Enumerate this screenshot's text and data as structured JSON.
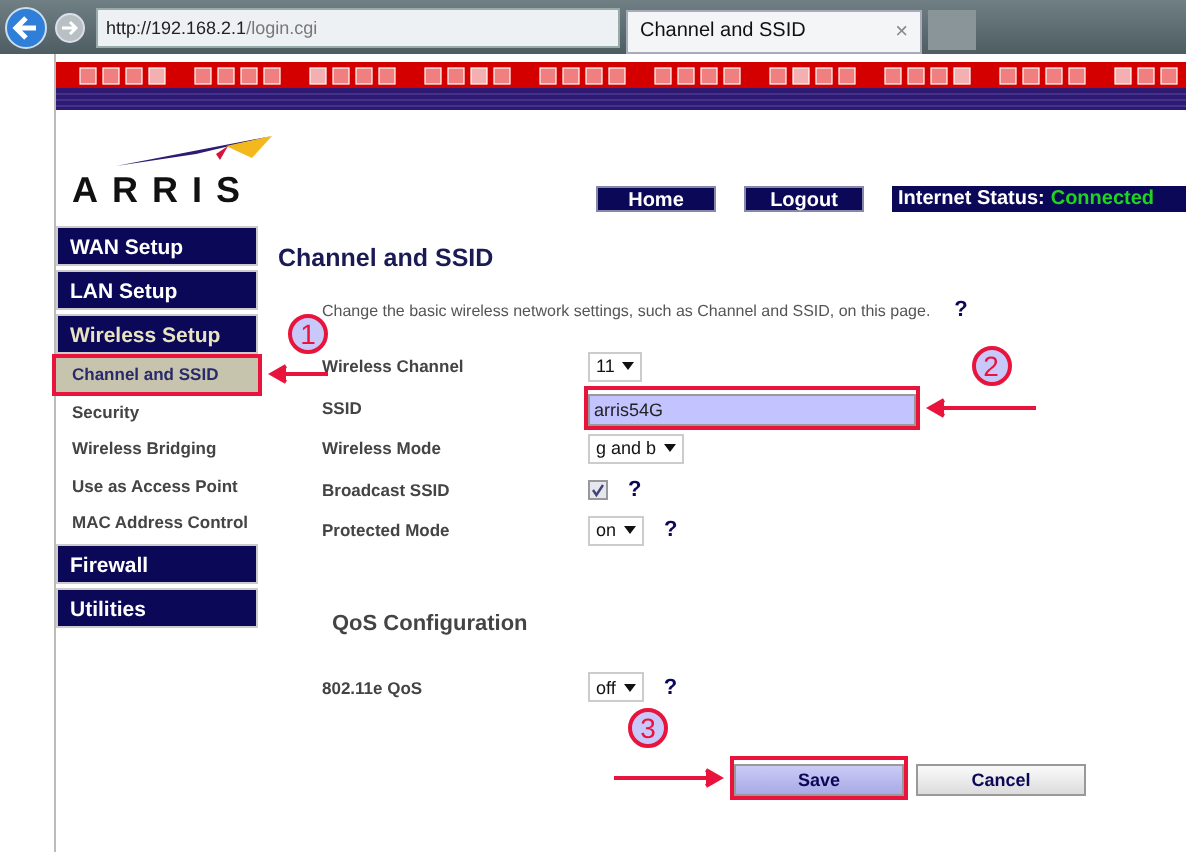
{
  "browser": {
    "address_host": "http://192.168.2.1",
    "address_path": "/login.cgi",
    "tab_title": "Channel and SSID",
    "tab_close": "×"
  },
  "header": {
    "logo": "ARRIS",
    "nav": [
      "Home",
      "Logout"
    ],
    "status_label": "Internet Status:",
    "status_value": "Connected"
  },
  "sidebar": {
    "items": [
      {
        "label": "WAN Setup",
        "kind": "section",
        "selected": false
      },
      {
        "label": "LAN Setup",
        "kind": "section",
        "selected": false
      },
      {
        "label": "Wireless Setup",
        "kind": "section",
        "selected": true
      },
      {
        "label": "Channel and SSID",
        "kind": "sub",
        "selected": true,
        "annotation": "1"
      },
      {
        "label": "Security",
        "kind": "sub",
        "selected": false
      },
      {
        "label": "Wireless Bridging",
        "kind": "sub",
        "selected": false
      },
      {
        "label": "Use as Access Point",
        "kind": "sub",
        "selected": false
      },
      {
        "label": "MAC Address Control",
        "kind": "sub",
        "selected": false
      },
      {
        "label": "Firewall",
        "kind": "section",
        "selected": false
      },
      {
        "label": "Utilities",
        "kind": "section",
        "selected": false
      }
    ]
  },
  "content": {
    "title": "Channel and SSID",
    "intro": "Change the basic wireless network settings, such as Channel and SSID, on this page.",
    "intro_help": "?",
    "fields": [
      {
        "kind": "select",
        "label": "Wireless Channel",
        "value": "11"
      },
      {
        "kind": "text",
        "label": "SSID",
        "value": "arris54G",
        "annotation": "2"
      },
      {
        "kind": "select",
        "label": "Wireless Mode",
        "value": "g and b"
      },
      {
        "kind": "checkbox",
        "label": "Broadcast SSID",
        "checked": true,
        "help": "?"
      },
      {
        "kind": "select",
        "label": "Protected Mode",
        "value": "on",
        "help": "?"
      }
    ],
    "qos_title": "QoS Configuration",
    "qos_fields": [
      {
        "kind": "select",
        "label": "802.11e QoS",
        "value": "off",
        "help": "?"
      }
    ],
    "buttons": [
      {
        "label": "Save",
        "kind": "primary",
        "annotation": "3"
      },
      {
        "label": "Cancel",
        "kind": "default"
      }
    ]
  }
}
